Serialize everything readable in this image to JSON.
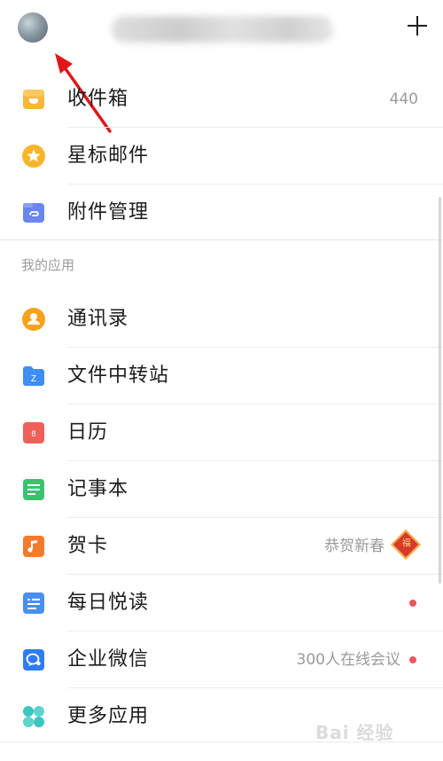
{
  "header": {
    "avatar_icon": "user-avatar",
    "add_icon": "plus-icon"
  },
  "mail_folders": [
    {
      "label": "收件箱",
      "count": "440",
      "icon": "inbox-icon",
      "color": "#f7b53c"
    },
    {
      "label": "星标邮件",
      "icon": "star-icon",
      "color": "#f7b52a"
    },
    {
      "label": "附件管理",
      "icon": "attachment-icon",
      "color": "#6b86f0"
    }
  ],
  "apps_section": {
    "title": "我的应用",
    "items": [
      {
        "label": "通讯录",
        "icon": "contacts-icon",
        "color": "#f6a21d"
      },
      {
        "label": "文件中转站",
        "icon": "file-transfer-icon",
        "color": "#3e8ef4"
      },
      {
        "label": "日历",
        "icon": "calendar-icon",
        "color": "#f0605a",
        "icon_text": "8"
      },
      {
        "label": "记事本",
        "icon": "notepad-icon",
        "color": "#3cc26f"
      },
      {
        "label": "贺卡",
        "icon": "greeting-card-icon",
        "color": "#f67a2d",
        "right_text": "恭贺新春",
        "badge_text": "福"
      },
      {
        "label": "每日悦读",
        "icon": "daily-reading-icon",
        "color": "#4a8ff0"
      },
      {
        "label": "企业微信",
        "icon": "wecom-icon",
        "color": "#2f7cf2",
        "right_text": "300人在线会议"
      },
      {
        "label": "更多应用",
        "icon": "more-apps-icon",
        "color": "#3bc6c0"
      }
    ]
  },
  "colors": {
    "notification_dot": "#e9575f",
    "annotation_arrow": "#e0161b"
  },
  "watermark": "Bai 经验"
}
